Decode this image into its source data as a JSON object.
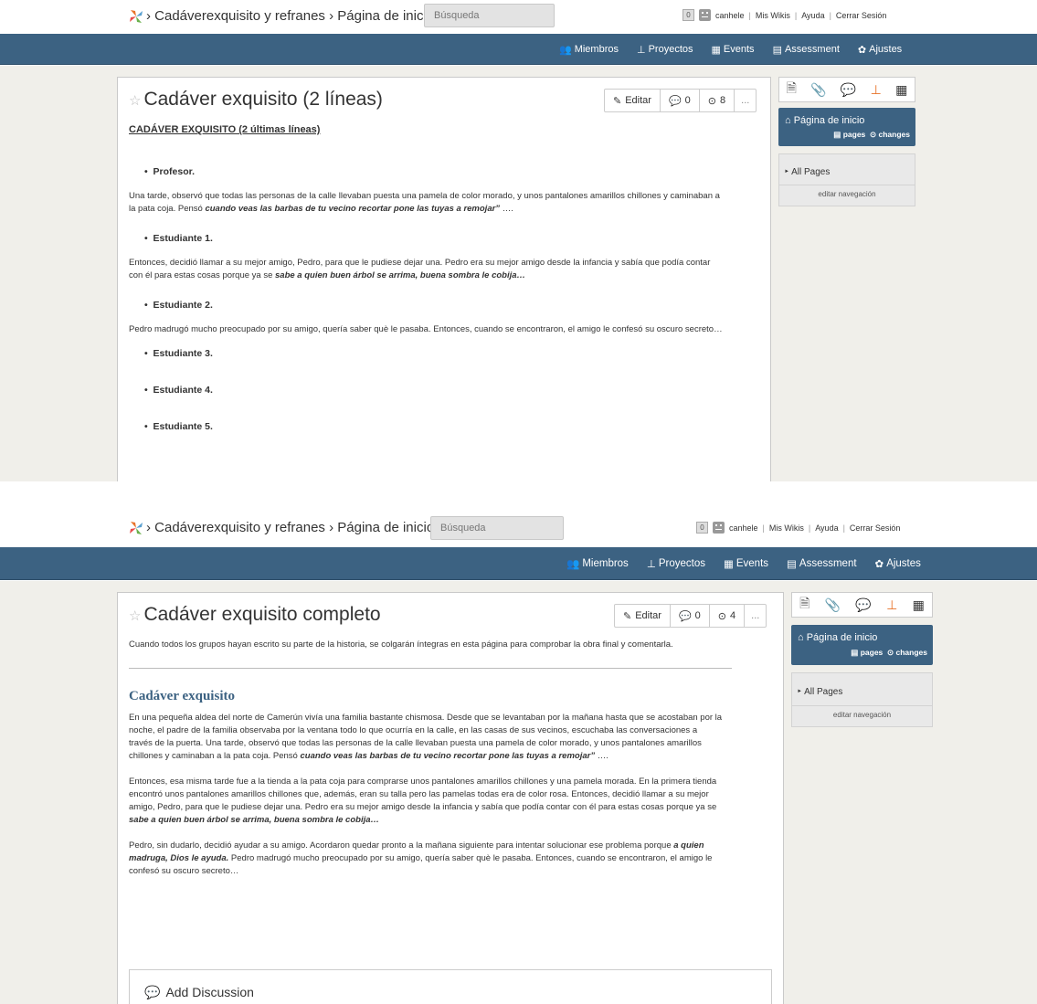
{
  "header": {
    "breadcrumb": "› Cadáverexquisito y refranes › Página de inicio",
    "search_placeholder": "Búsqueda",
    "notif_count": "0",
    "user": "canhele",
    "links": [
      "Mis Wikis",
      "Ayuda",
      "Cerrar Sesión"
    ]
  },
  "nav": {
    "items": [
      "Miembros",
      "Proyectos",
      "Events",
      "Assessment",
      "Ajustes"
    ]
  },
  "sidebar": {
    "home_label": "Página de inicio",
    "pages_label": "pages",
    "changes_label": "changes",
    "all_pages": "All Pages",
    "edit_nav": "editar navegación"
  },
  "shot1": {
    "title": "Cadáver exquisito (2 líneas)",
    "edit_label": "Editar",
    "comments": "0",
    "history": "8",
    "more": "...",
    "heading": "CADÁVER EXQUISITO (2 últimas líneas)",
    "b1": "Profesor.",
    "p1a": "Una tarde, observó que todas las personas de la calle llevaban puesta una pamela de color morado, y unos pantalones amarillos chillones y caminaban a la pata coja. Pensó ",
    "p1b": "cuando veas las barbas de tu vecino recortar pone las tuyas a remojar”",
    "p1c": " ….",
    "b2": "Estudiante 1.",
    "p2a": "Entonces, decidió llamar a su mejor amigo, Pedro, para que le pudiese dejar una. Pedro era su mejor amigo desde la infancia y sabía que podía contar con él para estas cosas porque ya se ",
    "p2b": "sabe a quien buen árbol se arrima, buena sombra le cobija…",
    "b3": "Estudiante 2.",
    "p3": "Pedro madrugó mucho preocupado por su amigo, quería saber què le pasaba. Entonces, cuando se encontraron, el amigo le confesó su oscuro secreto…",
    "b4": "Estudiante 3.",
    "b5": "Estudiante 4.",
    "b6": "Estudiante 5."
  },
  "shot2": {
    "title": "Cadáver exquisito completo",
    "edit_label": "Editar",
    "comments": "0",
    "history": "4",
    "more": "...",
    "intro": "Cuando todos los grupos hayan escrito su parte de la historia, se colgarán íntegras en esta página para comprobar la obra final y comentarla.",
    "subheading": "Cadáver exquisito",
    "p1a": "En una pequeña aldea del norte de Camerún vivía una familia bastante chismosa. Desde que se levantaban por la mañana hasta que se acostaban por la noche, el padre de la familia observaba por la ventana todo lo que ocurría en la calle, en las casas de sus vecinos, escuchaba las conversaciones a través de la puerta. Una tarde, observó que todas las personas de la calle llevaban puesta una pamela de color morado, y unos pantalones amarillos chillones y caminaban a la pata coja. Pensó ",
    "p1b": "cuando veas las barbas de tu vecino recortar pone las tuyas a remojar”",
    "p1c": " ….",
    "p2a": "Entonces, esa misma tarde fue a la tienda a la pata coja para comprarse unos pantalones amarillos chillones y una pamela morada. En la primera tienda encontró unos pantalones amarillos chillones que, además, eran su talla pero las pamelas todas era de color rosa. Entonces, decidió llamar a su mejor amigo, Pedro, para que le pudiese dejar una. Pedro era su mejor amigo desde la infancia y sabía que podía contar con él para estas cosas porque ya se ",
    "p2b": "sabe a quien buen árbol se arrima, buena sombra le cobija…",
    "p3a": "Pedro, sin dudarlo, decidió ayudar a su amigo. Acordaron quedar pronto a la mañana siguiente para intentar solucionar ese problema porque ",
    "p3b": "a quien madruga, Dios le ayuda.",
    "p3c": " Pedro madrugó mucho preocupado por su amigo, quería saber què le pasaba. Entonces, cuando se encontraron, el amigo le confesó su oscuro secreto…",
    "discussion": "Add Discussion"
  }
}
